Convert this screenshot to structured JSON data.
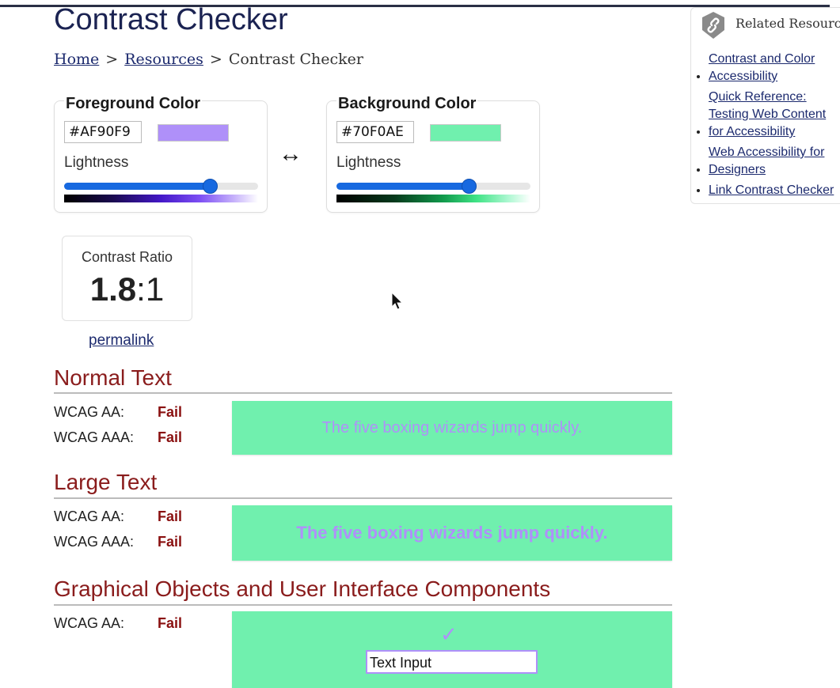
{
  "page": {
    "title": "Contrast Checker",
    "breadcrumb": {
      "home": "Home",
      "resources": "Resources",
      "current": "Contrast Checker",
      "separator": ">"
    }
  },
  "foreground": {
    "label": "Foreground Color",
    "hex": "#AF90F9",
    "swatch_color": "#AF90F9",
    "lightness_label": "Lightness",
    "lightness_value": 0.75
  },
  "background": {
    "label": "Background Color",
    "hex": "#70F0AE",
    "swatch_color": "#70F0AE",
    "lightness_label": "Lightness",
    "lightness_value": 0.68
  },
  "swap_glyph": "↔",
  "contrast": {
    "label": "Contrast Ratio",
    "value": "1.8",
    "suffix": ":1",
    "permalink": "permalink"
  },
  "normal_text": {
    "heading": "Normal Text",
    "aa_label": "WCAG AA:",
    "aa_result": "Fail",
    "aaa_label": "WCAG AAA:",
    "aaa_result": "Fail",
    "sample": "The five boxing wizards jump quickly."
  },
  "large_text": {
    "heading": "Large Text",
    "aa_label": "WCAG AA:",
    "aa_result": "Fail",
    "aaa_label": "WCAG AAA:",
    "aaa_result": "Fail",
    "sample": "The five boxing wizards jump quickly."
  },
  "graphical": {
    "heading": "Graphical Objects and User Interface Components",
    "aa_label": "WCAG AA:",
    "aa_result": "Fail",
    "check_glyph": "✓",
    "input_value": "Text Input"
  },
  "related": {
    "title": "Related Resources",
    "icon": "link-icon",
    "items": [
      {
        "label": "Contrast and Color Accessibility"
      },
      {
        "label": "Quick Reference: Testing Web Content for Accessibility"
      },
      {
        "label": "Web Accessibility for Designers"
      },
      {
        "label": "Link Contrast Checker"
      }
    ]
  },
  "colors": {
    "heading_red": "#8a1c1c",
    "link_blue": "#1c2a6e",
    "slider_blue": "#1769e0"
  }
}
